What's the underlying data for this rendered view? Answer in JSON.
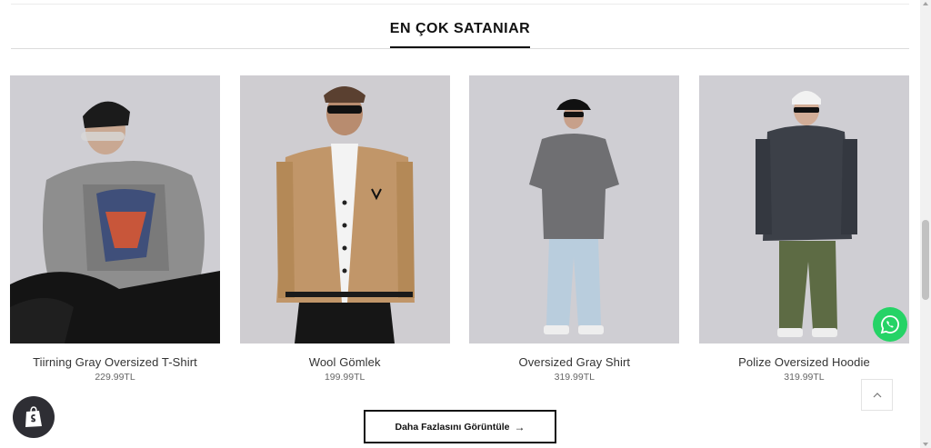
{
  "section": {
    "title": "EN ÇOK SATANIAR"
  },
  "products": [
    {
      "name": "Tiirning Gray Oversized T-Shirt",
      "price": "229.99TL",
      "image": "model-gray-graphic-tshirt"
    },
    {
      "name": "Wool Gömlek",
      "price": "199.99TL",
      "image": "model-tan-wool-cardigan"
    },
    {
      "name": "Oversized Gray Shirt",
      "price": "319.99TL",
      "image": "model-gray-denim-shirt"
    },
    {
      "name": "Polize Oversized Hoodie",
      "price": "319.99TL",
      "image": "model-charcoal-hoodie"
    }
  ],
  "more_button": {
    "label": "Daha Fazlasını Görüntüle",
    "icon": "arrow-right-icon"
  },
  "floating": {
    "whatsapp_icon": "whatsapp-icon",
    "shopify_icon": "shopify-bag-icon",
    "scroll_top_icon": "chevron-up-icon"
  },
  "colors": {
    "accent": "#111111",
    "whatsapp": "#25d366",
    "photo_bg": "#cfced3"
  }
}
